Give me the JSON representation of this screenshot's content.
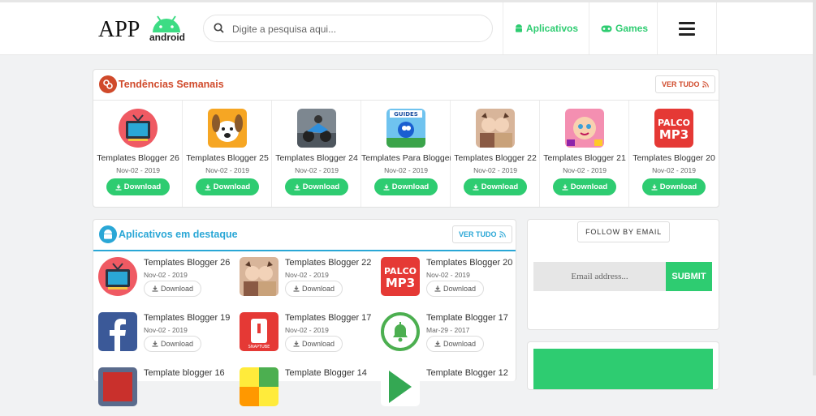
{
  "logo": {
    "text_app": "APP",
    "text_android": "android"
  },
  "search": {
    "placeholder": "Digite a pesquisa aqui..."
  },
  "nav": {
    "apps_label": "Aplicativos",
    "games_label": "Games"
  },
  "trends": {
    "title": "Tendências Semanais",
    "ver_tudo": "VER TUDO",
    "items": [
      {
        "name": "Templates Blogger 26",
        "date": "Nov-02 - 2019",
        "download": "Download",
        "icon": "tv-icon"
      },
      {
        "name": "Templates Blogger 25",
        "date": "Nov-02 - 2019",
        "download": "Download",
        "icon": "dog-icon"
      },
      {
        "name": "Templates Blogger 24",
        "date": "Nov-02 - 2019",
        "download": "Download",
        "icon": "moto-racing-icon"
      },
      {
        "name": "Templates Para Blogger",
        "date": "Nov-02 - 2019",
        "download": "Download",
        "icon": "sonic-guides-icon"
      },
      {
        "name": "Templates Blogger 22",
        "date": "Nov-02 - 2019",
        "download": "Download",
        "icon": "photo-filter-icon"
      },
      {
        "name": "Templates Blogger 21",
        "date": "Nov-02 - 2019",
        "download": "Download",
        "icon": "makeup-game-icon"
      },
      {
        "name": "Templates Blogger 20",
        "date": "Nov-02 - 2019",
        "download": "Download",
        "icon": "palco-mp3-icon"
      }
    ]
  },
  "featured": {
    "title": "Aplicativos em destaque",
    "ver_tudo": "VER TUDO",
    "items": [
      {
        "name": "Templates Blogger 26",
        "date": "Nov-02 - 2019",
        "download": "Download",
        "icon": "tv-icon"
      },
      {
        "name": "Templates Blogger 22",
        "date": "Nov-02 - 2019",
        "download": "Download",
        "icon": "photo-filter-icon"
      },
      {
        "name": "Templates Blogger 20",
        "date": "Nov-02 - 2019",
        "download": "Download",
        "icon": "palco-mp3-icon"
      },
      {
        "name": "Templates Blogger 19",
        "date": "Nov-02 - 2019",
        "download": "Download",
        "icon": "facebook-icon"
      },
      {
        "name": "Templates Blogger 17",
        "date": "Nov-02 - 2019",
        "download": "Download",
        "icon": "snaptube-icon"
      },
      {
        "name": "Template Blogger 17",
        "date": "Mar-29 - 2017",
        "download": "Download",
        "icon": "bell-icon"
      },
      {
        "name": "Template blogger 16",
        "date": "",
        "download": "",
        "icon": "game-icon"
      },
      {
        "name": "Template Blogger 14",
        "date": "",
        "download": "",
        "icon": "colorful-icon"
      },
      {
        "name": "Template Blogger 12",
        "date": "",
        "download": "",
        "icon": "play-icon"
      }
    ]
  },
  "follow": {
    "title": "FOLLOW BY EMAIL",
    "email_placeholder": "Email address...",
    "submit": "SUBMIT"
  },
  "colors": {
    "accent": "#2ecc71",
    "trend_title": "#d04a2b",
    "featured_title": "#2aa7d6"
  }
}
